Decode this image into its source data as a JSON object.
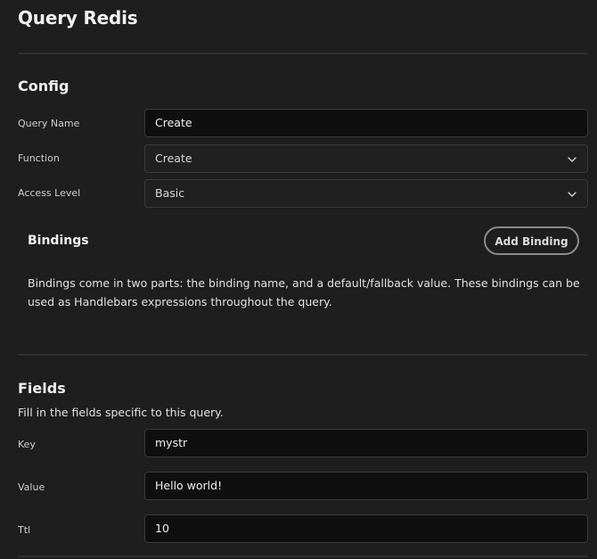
{
  "page": {
    "title": "Query Redis"
  },
  "config": {
    "title": "Config",
    "query_name": {
      "label": "Query Name",
      "value": "Create"
    },
    "function": {
      "label": "Function",
      "value": "Create"
    },
    "access_level": {
      "label": "Access Level",
      "value": "Basic"
    }
  },
  "bindings": {
    "title": "Bindings",
    "add_label": "Add Binding",
    "description": "Bindings come in two parts: the binding name, and a default/fallback value. These bindings can be used as Handlebars expressions throughout the query."
  },
  "fields": {
    "title": "Fields",
    "description": "Fill in the fields specific to this query.",
    "key": {
      "label": "Key",
      "value": "mystr"
    },
    "value": {
      "label": "Value",
      "value": "Hello world!"
    },
    "ttl": {
      "label": "Ttl",
      "value": "10"
    }
  },
  "icons": {
    "select_arrow": "chevron-down-icon"
  }
}
